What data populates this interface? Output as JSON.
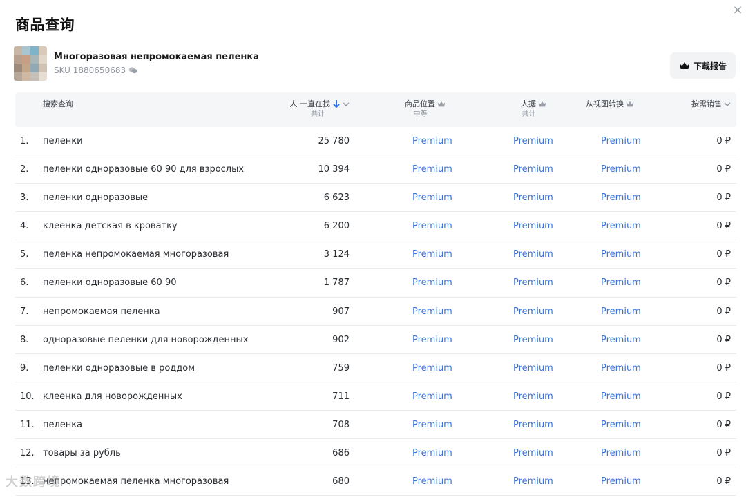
{
  "modal": {
    "title": "商品查询",
    "close_label": "×"
  },
  "product": {
    "name": "Многоразовая непромокаемая пеленка",
    "sku": "SKU 1880650683",
    "thumb_colors": [
      "#c9b7a6",
      "#a8c5d1",
      "#7fb3c8",
      "#d8c9b8",
      "#b7a08e",
      "#c89f84",
      "#a9b6b8",
      "#e2d6c9",
      "#9c8a7c",
      "#c4a588",
      "#8fa9b5",
      "#d1c3b4",
      "#b5a79a",
      "#d0b9a3",
      "#c7c0b8",
      "#e6ddd3"
    ]
  },
  "toolbar": {
    "download_label": "下载报告"
  },
  "columns": {
    "query": "搜索查询",
    "searches": "人 一直在找",
    "searches_sub": "共计",
    "position": "商品位置",
    "position_sub": "中等",
    "people": "人据",
    "people_sub": "共计",
    "conversion": "从视图转换",
    "sales": "按需销售"
  },
  "rows": [
    {
      "num": "1.",
      "query": "пеленки",
      "count": "25 780",
      "p1": "Premium",
      "p2": "Premium",
      "p3": "Premium",
      "sales": "0 ₽"
    },
    {
      "num": "2.",
      "query": "пеленки одноразовые 60 90 для взрослых",
      "count": "10 394",
      "p1": "Premium",
      "p2": "Premium",
      "p3": "Premium",
      "sales": "0 ₽"
    },
    {
      "num": "3.",
      "query": "пеленки одноразовые",
      "count": "6 623",
      "p1": "Premium",
      "p2": "Premium",
      "p3": "Premium",
      "sales": "0 ₽"
    },
    {
      "num": "4.",
      "query": "клеенка детская в кроватку",
      "count": "6 200",
      "p1": "Premium",
      "p2": "Premium",
      "p3": "Premium",
      "sales": "0 ₽"
    },
    {
      "num": "5.",
      "query": "пеленка непромокаемая многоразовая",
      "count": "3 124",
      "p1": "Premium",
      "p2": "Premium",
      "p3": "Premium",
      "sales": "0 ₽"
    },
    {
      "num": "6.",
      "query": "пеленки одноразовые 60 90",
      "count": "1 787",
      "p1": "Premium",
      "p2": "Premium",
      "p3": "Premium",
      "sales": "0 ₽"
    },
    {
      "num": "7.",
      "query": "непромокаемая пеленка",
      "count": "907",
      "p1": "Premium",
      "p2": "Premium",
      "p3": "Premium",
      "sales": "0 ₽"
    },
    {
      "num": "8.",
      "query": "одноразовые пеленки для новорожденных",
      "count": "902",
      "p1": "Premium",
      "p2": "Premium",
      "p3": "Premium",
      "sales": "0 ₽"
    },
    {
      "num": "9.",
      "query": "пеленки одноразовые в роддом",
      "count": "759",
      "p1": "Premium",
      "p2": "Premium",
      "p3": "Premium",
      "sales": "0 ₽"
    },
    {
      "num": "10.",
      "query": "клеенка для новорожденных",
      "count": "711",
      "p1": "Premium",
      "p2": "Premium",
      "p3": "Premium",
      "sales": "0 ₽"
    },
    {
      "num": "11.",
      "query": "пеленка",
      "count": "708",
      "p1": "Premium",
      "p2": "Premium",
      "p3": "Premium",
      "sales": "0 ₽"
    },
    {
      "num": "12.",
      "query": "товары за рубль",
      "count": "686",
      "p1": "Premium",
      "p2": "Premium",
      "p3": "Premium",
      "sales": "0 ₽"
    },
    {
      "num": "13.",
      "query": "непромокаемая пеленка многоразовая",
      "count": "680",
      "p1": "Premium",
      "p2": "Premium",
      "p3": "Premium",
      "sales": "0 ₽"
    }
  ],
  "watermark": "大数跨境",
  "colors": {
    "accent": "#2f6fe0",
    "premium": "#3b74d8",
    "header_bg": "#f5f6f8"
  }
}
